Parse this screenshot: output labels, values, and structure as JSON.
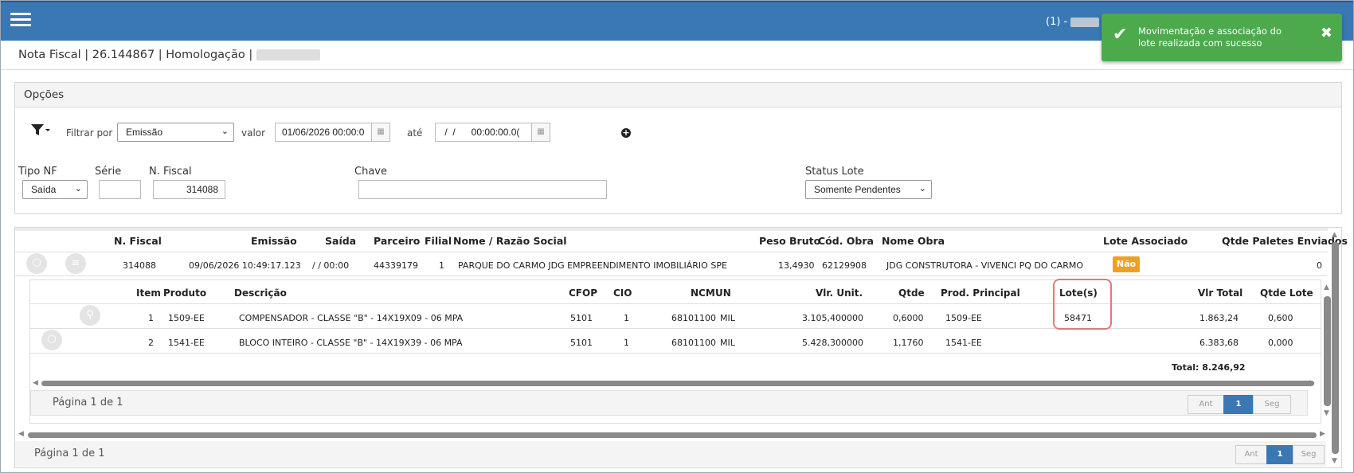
{
  "topbar": {
    "user_prefix": "(1) - ",
    "toast_message": "Movimentação e associação do lote realizada com sucesso",
    "toast_close": "✖"
  },
  "page": {
    "title": "Nota Fiscal | 26.144867 | Homologação |"
  },
  "options": {
    "title": "Opções",
    "filtrar_por_label": "Filtrar por",
    "filtrar_por_value": "Emissão",
    "valor_label": "valor",
    "valor_value": "01/06/2026 00:00:0",
    "ate_label": "até",
    "ate_value": " /  /      00:00:00.0(",
    "tipo_nf_label": "Tipo NF",
    "tipo_nf_value": "Saída",
    "serie_label": "Série",
    "serie_value": "",
    "nfiscal_label": "N. Fiscal",
    "nfiscal_value": "314088",
    "chave_label": "Chave",
    "chave_value": "",
    "status_lote_label": "Status Lote",
    "status_lote_value": "Somente Pendentes"
  },
  "main_table": {
    "headers": {
      "nfiscal": "N. Fiscal",
      "emissao": "Emissão",
      "saida": "Saída",
      "parceiro": "Parceiro",
      "filial": "Filial",
      "nome": "Nome / Razão Social",
      "peso": "Peso Bruto",
      "cod_obra": "Cód. Obra",
      "nome_obra": "Nome Obra",
      "lote": "Lote Associado",
      "qtde_paletes": "Qtde Paletes Enviados"
    },
    "row": {
      "nfiscal": "314088",
      "emissao": "09/06/2026 10:49:17.123",
      "saida": "/ / 00:00",
      "parceiro": "44339179",
      "filial": "1",
      "nome": "PARQUE DO CARMO JDG EMPREENDIMENTO IMOBILIÁRIO SPE",
      "peso": "13,4930",
      "cod_obra": "62129908",
      "nome_obra": "JDG CONSTRUTORA - VIVENCI PQ DO CARMO",
      "lote": "Não",
      "qtde_paletes": "0"
    },
    "pagination": {
      "text": "Página 1 de 1",
      "prev": "Ant",
      "current": "1",
      "next": "Seg"
    }
  },
  "sub_table": {
    "headers": {
      "item": "Item",
      "produto": "Produto",
      "descricao": "Descrição",
      "cfop": "CFOP",
      "cio": "CIO",
      "ncm": "NCM",
      "un": "UN",
      "vlr_unit": "Vlr. Unit.",
      "qtde": "Qtde",
      "prod_principal": "Prod. Principal",
      "lotes": "Lote(s)",
      "vlr_total": "Vlr Total",
      "qtde_lote": "Qtde Lote"
    },
    "rows": [
      {
        "item": "1",
        "produto": "1509-EE",
        "descricao": "COMPENSADOR - CLASSE \"B\" - 14X19X09 - 06 MPA",
        "cfop": "5101",
        "cio": "1",
        "ncm": "68101100",
        "un": "MIL",
        "vlr_unit": "3.105,400000",
        "qtde": "0,6000",
        "prod_principal": "1509-EE",
        "lotes": "58471",
        "vlr_total": "1.863,24",
        "qtde_lote": "0,600"
      },
      {
        "item": "2",
        "produto": "1541-EE",
        "descricao": "BLOCO INTEIRO - CLASSE \"B\" - 14X19X39 - 06 MPA",
        "cfop": "5101",
        "cio": "1",
        "ncm": "68101100",
        "un": "MIL",
        "vlr_unit": "5.428,300000",
        "qtde": "1,1760",
        "prod_principal": "1541-EE",
        "lotes": "",
        "vlr_total": "6.383,68",
        "qtde_lote": "0,000"
      }
    ],
    "total": "Total: 8.246,92",
    "pagination": {
      "text": "Página 1 de 1",
      "prev": "Ant",
      "current": "1",
      "next": "Seg"
    }
  },
  "colors": {
    "topbar": "#3a78b4",
    "toast": "#4caa4c",
    "badge_nao": "#f0a020",
    "highlight": "#e07a7a"
  }
}
